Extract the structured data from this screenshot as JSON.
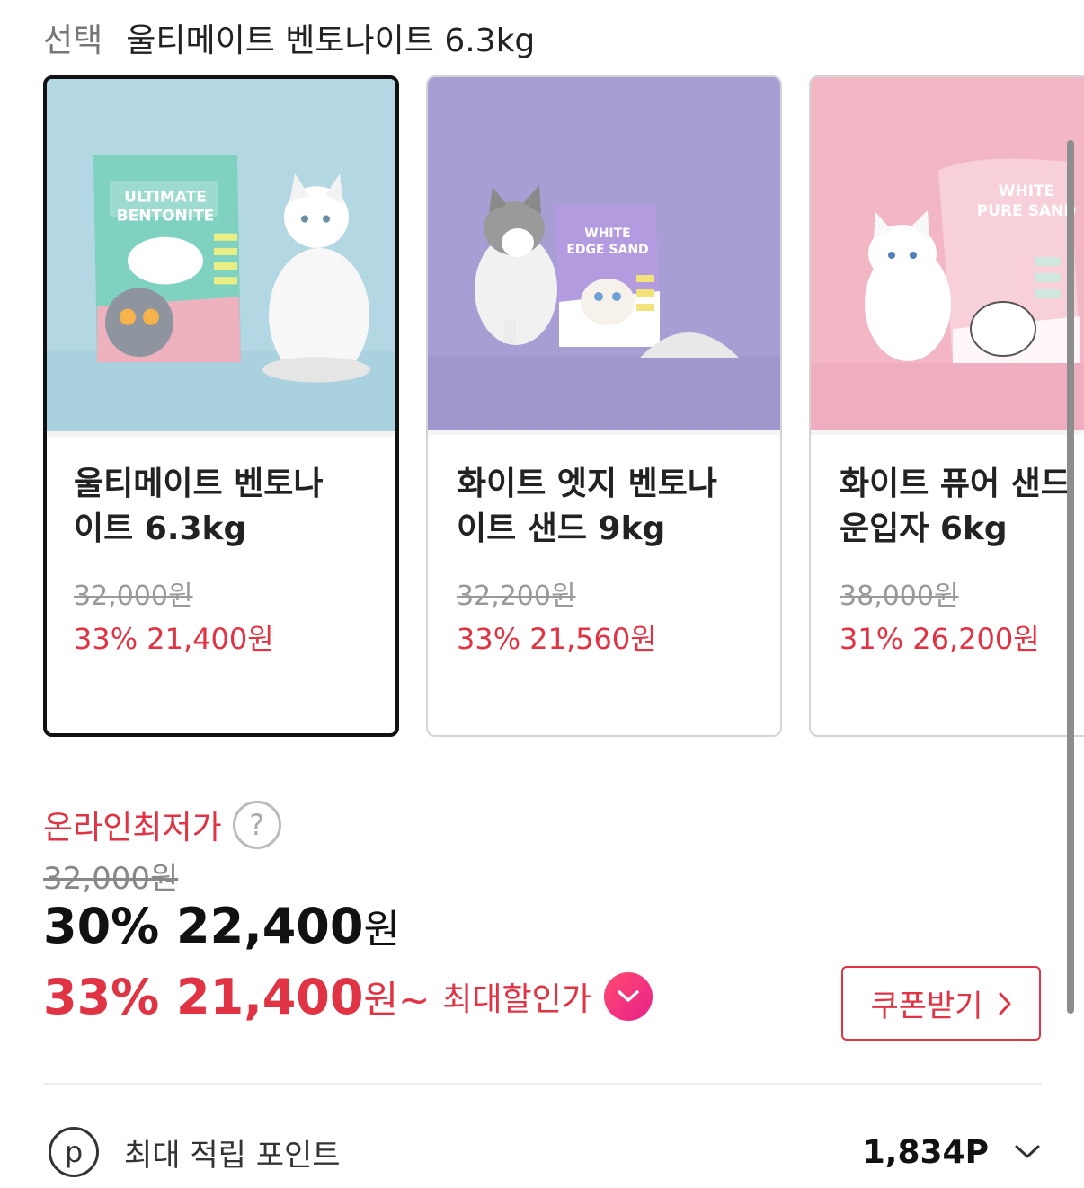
{
  "selection": {
    "label": "선택",
    "value": "울티메이트 벤토나이트 6.3kg"
  },
  "products": [
    {
      "name_line1": "울티메이트 벤토나",
      "name_line2": "이트 6.3kg",
      "original_price": "32,000원",
      "sale_price": "33% 21,400원",
      "selected": true,
      "package_text": [
        "ULTIMATE",
        "BENTONITE"
      ],
      "colors": {
        "background": "#b3d8e4",
        "package": "#7fd1c0",
        "package_bottom": "#eeb2bf"
      }
    },
    {
      "name_line1": "화이트 엣지 벤토나",
      "name_line2": "이트 샌드 9kg",
      "original_price": "32,200원",
      "sale_price": "33% 21,560원",
      "selected": false,
      "package_text": [
        "WHITE",
        "EDGE SAND"
      ],
      "colors": {
        "background": "#a79fd4",
        "package": "#b39be0",
        "package_bottom": "#ffffff"
      }
    },
    {
      "name_line1": "화이트 퓨어 샌드",
      "name_line2": "운입자 6kg",
      "original_price": "38,000원",
      "sale_price": "31% 26,200원",
      "selected": false,
      "package_text": [
        "WHITE",
        "PURE SAND"
      ],
      "colors": {
        "background": "#f2b6c5",
        "package": "#f7d0d9",
        "package_bottom": "#ffffff"
      }
    }
  ],
  "pricing": {
    "lowest_label": "온라인최저가",
    "help_glyph": "?",
    "original": "32,000원",
    "current_amount": "30% 22,400",
    "current_unit": "원",
    "max_amount": "33% 21,400",
    "max_unit": "원~",
    "max_label": "최대할인가",
    "coupon_button": "쿠폰받기"
  },
  "points": {
    "icon_glyph": "p",
    "label": "최대 적립 포인트",
    "value": "1,834P"
  },
  "icons": {
    "help": "question-circle-icon",
    "max_discount": "chevron-down-badge-icon",
    "coupon": "chevron-right-icon",
    "points": "point-circle-icon",
    "expand": "chevron-down-icon"
  },
  "colors": {
    "accent": "#e03344",
    "text": "#222222",
    "muted": "#888888"
  }
}
